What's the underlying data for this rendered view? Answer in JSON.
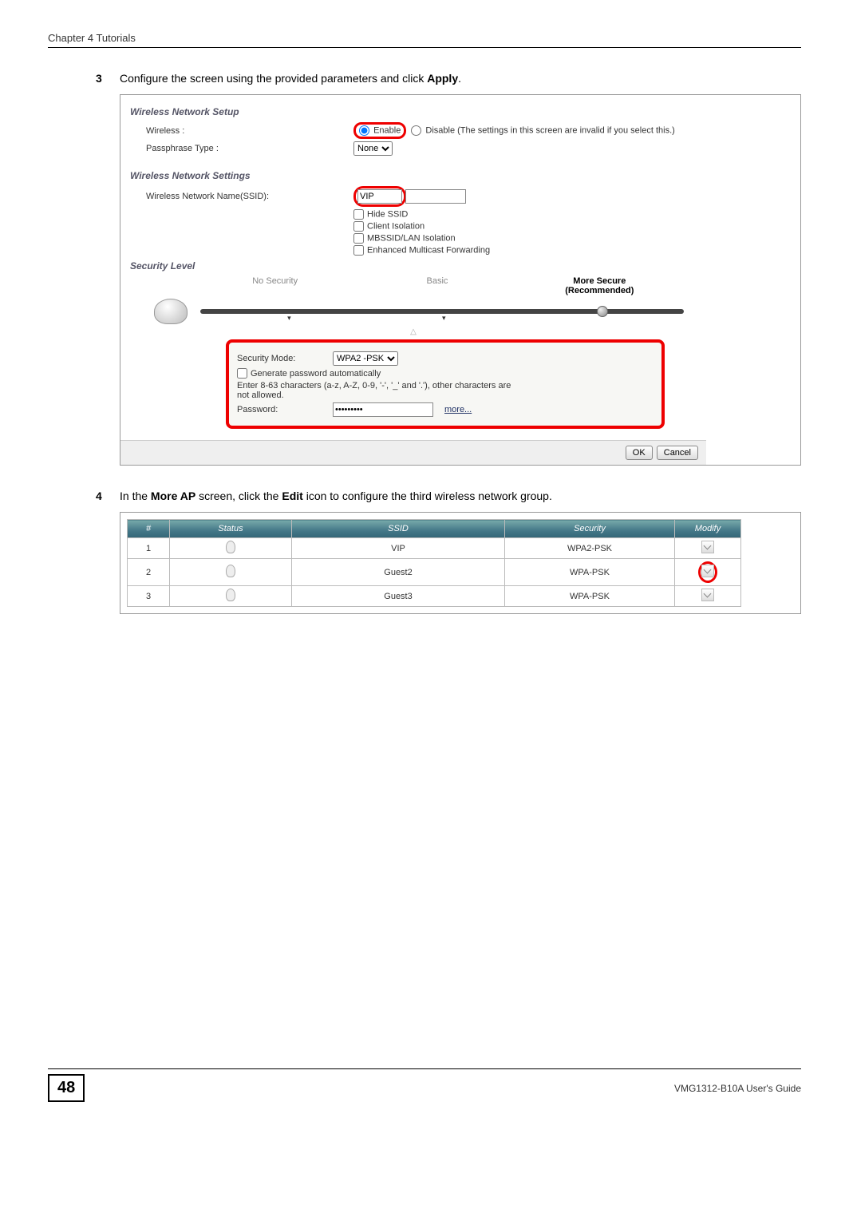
{
  "header": {
    "chapter": "Chapter 4 Tutorials"
  },
  "steps": {
    "s3": {
      "num": "3",
      "text_before": "Configure the screen using the provided parameters and click ",
      "bold": "Apply",
      "text_after": "."
    },
    "s4": {
      "num": "4",
      "prefix": "In the ",
      "bold1": "More AP",
      "mid1": " screen, click the ",
      "bold2": "Edit",
      "mid2": " icon to configure the third wireless network group."
    }
  },
  "fig1": {
    "setup_title": "Wireless Network Setup",
    "wireless_label": "Wireless :",
    "enable": "Enable",
    "disable": "Disable (The settings in this screen are invalid if you select this.)",
    "passphrase_label": "Passphrase Type :",
    "passphrase_value": "None",
    "settings_title": "Wireless Network Settings",
    "ssid_label": "Wireless Network Name(SSID):",
    "ssid_value": "VIP",
    "hide_ssid": "Hide SSID",
    "client_iso": "Client Isolation",
    "mbssid": "MBSSID/LAN Isolation",
    "emf": "Enhanced Multicast Forwarding",
    "seclevel_title": "Security Level",
    "nosec": "No Security",
    "basic": "Basic",
    "moresec1": "More Secure",
    "moresec2": "(Recommended)",
    "secmode_label": "Security Mode:",
    "secmode_value": "WPA2 -PSK",
    "genpw": "Generate password automatically",
    "pw_hint": "Enter 8-63 characters (a-z, A-Z, 0-9, '-', '_' and '.'), other characters are not allowed.",
    "pw_label": "Password:",
    "pw_value": "•••••••••",
    "more": "more...",
    "ok": "OK",
    "cancel": "Cancel"
  },
  "fig2": {
    "headers": {
      "num": "#",
      "status": "Status",
      "ssid": "SSID",
      "security": "Security",
      "modify": "Modify"
    },
    "rows": [
      {
        "n": "1",
        "ssid": "VIP",
        "sec": "WPA2-PSK",
        "highlight": false
      },
      {
        "n": "2",
        "ssid": "Guest2",
        "sec": "WPA-PSK",
        "highlight": true
      },
      {
        "n": "3",
        "ssid": "Guest3",
        "sec": "WPA-PSK",
        "highlight": false
      }
    ]
  },
  "footer": {
    "page": "48",
    "guide": "VMG1312-B10A User's Guide"
  }
}
